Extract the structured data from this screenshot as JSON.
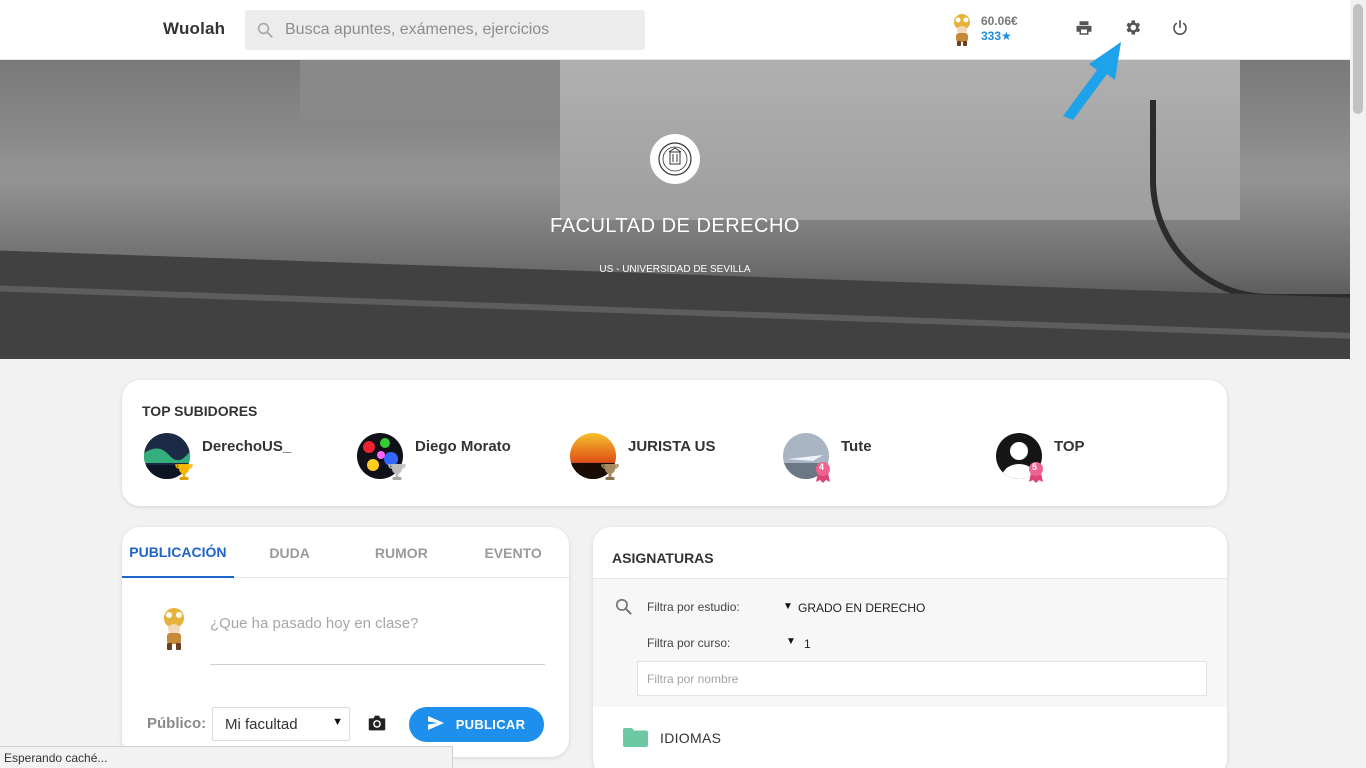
{
  "header": {
    "logo": "Wuolah",
    "search_placeholder": "Busca apuntes, exámenes, ejercicios",
    "balance": "60.06€",
    "stars": "333★",
    "icons": [
      "print-icon",
      "gear-icon",
      "power-icon"
    ]
  },
  "hero": {
    "title": "FACULTAD DE DERECHO",
    "subtitle": "US - UNIVERSIDAD DE SEVILLA"
  },
  "top_uploaders": {
    "title": "TOP SUBIDORES",
    "items": [
      {
        "name": "DerechoUS_",
        "badge": "gold-trophy-icon"
      },
      {
        "name": "Diego Morato",
        "badge": "silver-trophy-icon"
      },
      {
        "name": "JURISTA US",
        "badge": "bronze-trophy-icon"
      },
      {
        "name": "Tute",
        "badge_num": "4"
      },
      {
        "name": "TOP",
        "badge_num": "5"
      }
    ]
  },
  "post": {
    "tabs": [
      "PUBLICACIÓN",
      "DUDA",
      "RUMOR",
      "EVENTO"
    ],
    "placeholder": "¿Que ha pasado hoy en clase?",
    "public_label": "Público:",
    "audience": "Mi facultad",
    "publish_label": "PUBLICAR"
  },
  "subjects": {
    "title": "ASIGNATURAS",
    "filter_study_label": "Filtra por estudio:",
    "filter_study_value": "GRADO EN DERECHO",
    "filter_course_label": "Filtra por curso:",
    "filter_course_value": "1",
    "filter_name_placeholder": "Filtra por nombre",
    "folders": [
      "IDIOMAS"
    ],
    "colors": {
      "folder": "#6cc9a3"
    }
  },
  "status_bar": "Esperando caché...",
  "colors": {
    "accent": "#1f8fee",
    "tab_active": "#1d63c9",
    "stars": "#1c8fe0"
  }
}
